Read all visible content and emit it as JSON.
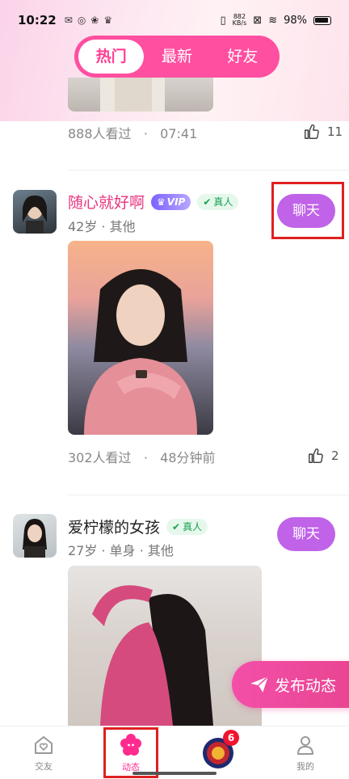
{
  "status_bar": {
    "time": "10:22",
    "net_speed_value": "882",
    "net_speed_unit": "KB/s",
    "battery": "98%"
  },
  "tabs": [
    {
      "label": "热门",
      "active": true
    },
    {
      "label": "最新",
      "active": false
    },
    {
      "label": "好友",
      "active": false
    }
  ],
  "posts": [
    {
      "views": "888人看过",
      "time": "07:41",
      "likes": "11"
    },
    {
      "name": "随心就好啊",
      "vip": "VIP",
      "verified": "真人",
      "details": "42岁 · 其他",
      "chat": "聊天",
      "views": "302人看过",
      "time": "48分钟前",
      "likes": "2"
    },
    {
      "name": "爱柠檬的女孩",
      "verified": "真人",
      "details": "27岁 · 单身 · 其他",
      "chat": "聊天"
    }
  ],
  "publish_button": "发布动态",
  "bottom_nav": [
    {
      "label": "交友",
      "icon": "heart-home-icon",
      "active": false
    },
    {
      "label": "动态",
      "icon": "flower-icon",
      "active": true
    },
    {
      "label": "",
      "icon": "game-avatar-icon",
      "badge": "6",
      "active": false
    },
    {
      "label": "我的",
      "icon": "user-icon",
      "active": false
    }
  ],
  "colors": {
    "accent": "#ff4fa0",
    "chat_button": "#c063e8",
    "highlight": "#e0201f",
    "vip": "#7d62ff",
    "verified": "#1aa152"
  }
}
